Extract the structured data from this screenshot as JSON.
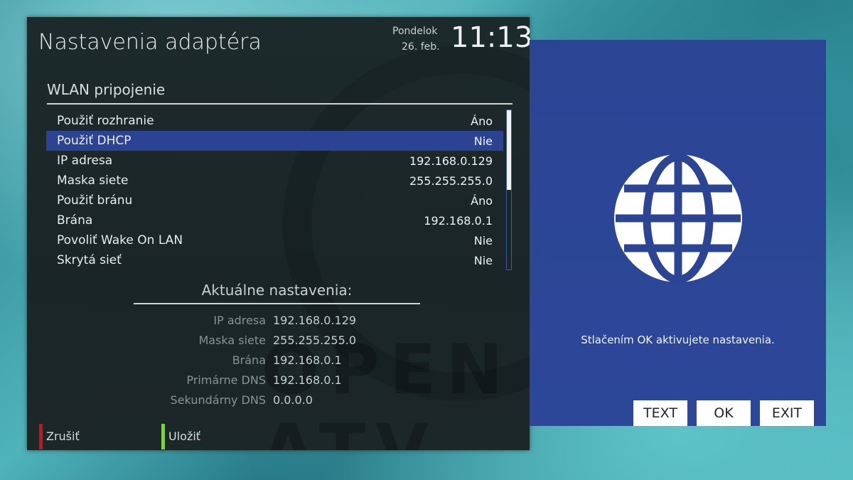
{
  "header": {
    "title": "Nastavenia adaptéra",
    "day": "Pondelok",
    "date": "26. feb.",
    "time": "11:13"
  },
  "section_title": "WLAN pripojenie",
  "settings": [
    {
      "label": "Použiť rozhranie",
      "value": "Áno"
    },
    {
      "label": "Použiť DHCP",
      "value": "Nie",
      "selected": true
    },
    {
      "label": "IP adresa",
      "value": "192.168.0.129"
    },
    {
      "label": "Maska siete",
      "value": "255.255.255.0"
    },
    {
      "label": "Použiť bránu",
      "value": "Áno"
    },
    {
      "label": "Brána",
      "value": "192.168.0.1"
    },
    {
      "label": "Povoliť Wake On LAN",
      "value": "Nie"
    },
    {
      "label": "Skrytá sieť",
      "value": "Nie"
    }
  ],
  "current": {
    "title": "Aktuálne nastavenia:",
    "rows": [
      {
        "key": "IP adresa",
        "value": "192.168.0.129"
      },
      {
        "key": "Maska siete",
        "value": "255.255.255.0"
      },
      {
        "key": "Brána",
        "value": "192.168.0.1"
      },
      {
        "key": "Primárne DNS",
        "value": "192.168.0.1"
      },
      {
        "key": "Sekundárny DNS",
        "value": "0.0.0.0"
      }
    ]
  },
  "color_buttons": {
    "red": {
      "label": "Zrušiť",
      "color": "#c4161c"
    },
    "green": {
      "label": "Uložiť",
      "color": "#6fe01f"
    }
  },
  "side": {
    "icon": "globe-icon",
    "hint": "Stlačením OK aktivujete nastavenia.",
    "buttons": {
      "text": "TEXT",
      "ok": "OK",
      "exit": "EXIT"
    }
  },
  "colors": {
    "selection": "#2b4392",
    "side_panel": "#2c4494"
  },
  "watermark": "OPEN ATV"
}
